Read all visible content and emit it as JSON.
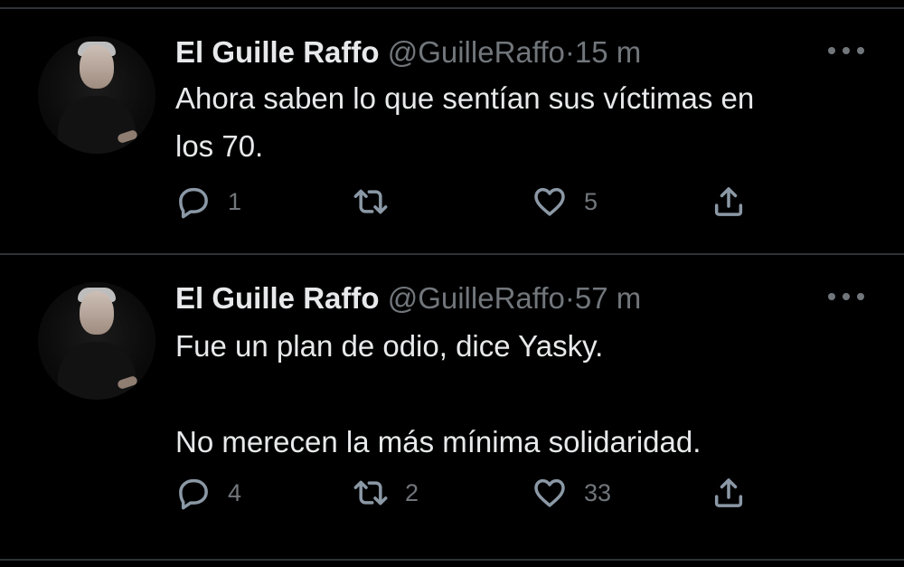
{
  "tweets": [
    {
      "name": "El Guille Raffo",
      "handle": "@GuilleRaffo",
      "separator": "·",
      "time": "15 m",
      "text": "Ahora saben lo que sentían sus víctimas en\nlos 70.",
      "actions": {
        "replies": "1",
        "retweets": "",
        "likes": "5"
      }
    },
    {
      "name": "El Guille Raffo",
      "handle": "@GuilleRaffo",
      "separator": "·",
      "time": "57 m",
      "text": "Fue un plan de odio, dice Yasky.\n\nNo merecen la más mínima solidaridad.",
      "actions": {
        "replies": "4",
        "retweets": "2",
        "likes": "33"
      }
    }
  ],
  "icons": {
    "reply": "reply-icon",
    "retweet": "retweet-icon",
    "like": "heart-icon",
    "share": "share-icon",
    "more": "more-icon"
  },
  "colors": {
    "background": "#000000",
    "text": "#e7e9ea",
    "muted": "#71767b",
    "divider": "#2f3336"
  }
}
